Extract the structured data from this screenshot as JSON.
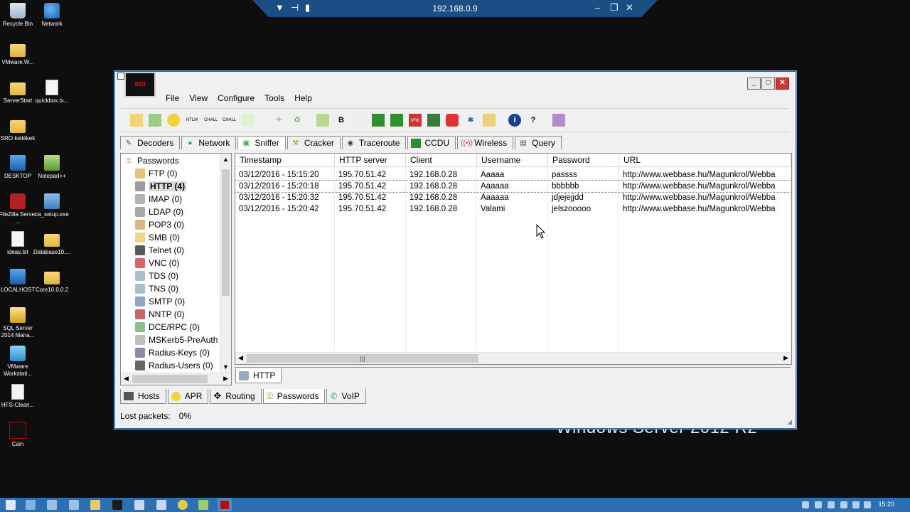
{
  "remote": {
    "title": "192.168.0.9"
  },
  "desktop": {
    "icons": [
      {
        "label": "Recycle Bin"
      },
      {
        "label": "Network"
      },
      {
        "label": "VMware.W..."
      },
      {
        "label": "ServerStart"
      },
      {
        "label": "quickbox.tx..."
      },
      {
        "label": "SRO kellékek"
      },
      {
        "label": "DESKTOP"
      },
      {
        "label": "Notepad++"
      },
      {
        "label": "FileZilla Server ..."
      },
      {
        "label": "ca_setup.exe"
      },
      {
        "label": "ideas.txt"
      },
      {
        "label": "Database10...."
      },
      {
        "label": "LOCALHOST"
      },
      {
        "label": "Core10.0.0.2"
      },
      {
        "label": "SQL Server 2014 Mana..."
      },
      {
        "label": "VMware Workstati..."
      },
      {
        "label": "HFS-Clean..."
      },
      {
        "label": "Cain"
      }
    ],
    "watermark": "Windows Server 2012 R2"
  },
  "window": {
    "logo": "aın",
    "menu": [
      "File",
      "View",
      "Configure",
      "Tools",
      "Help"
    ],
    "tabs": [
      "Decoders",
      "Network",
      "Sniffer",
      "Cracker",
      "Traceroute",
      "CCDU",
      "Wireless",
      "Query"
    ],
    "tree": {
      "root": "Passwords",
      "items": [
        "FTP (0)",
        "HTTP (4)",
        "IMAP (0)",
        "LDAP (0)",
        "POP3 (0)",
        "SMB (0)",
        "Telnet (0)",
        "VNC (0)",
        "TDS (0)",
        "TNS (0)",
        "SMTP (0)",
        "NNTP (0)",
        "DCE/RPC (0)",
        "MSKerb5-PreAuth",
        "Radius-Keys (0)",
        "Radius-Users (0)"
      ]
    },
    "table": {
      "columns": [
        "Timestamp",
        "HTTP server",
        "Client",
        "Username",
        "Password",
        "URL"
      ],
      "rows": [
        [
          "03/12/2016 - 15:15:20",
          "195.70.51.42",
          "192.168.0.28",
          "Aaaaa",
          "passss",
          "http://www.webbase.hu/Magunkrol/Webba"
        ],
        [
          "03/12/2016 - 15:20:18",
          "195.70.51.42",
          "192.168.0.28",
          "Aaaaaa",
          "bbbbbb",
          "http://www.webbase.hu/Magunkrol/Webba"
        ],
        [
          "03/12/2016 - 15:20:32",
          "195.70.51.42",
          "192.168.0.28",
          "Aaaaaa",
          "jdjejejjdd",
          "http://www.webbase.hu/Magunkrol/Webba"
        ],
        [
          "03/12/2016 - 15:20:42",
          "195.70.51.42",
          "192.168.0.28",
          "Valami",
          "jelszooooo",
          "http://www.webbase.hu/Magunkrol/Webba"
        ]
      ]
    },
    "subtab": "HTTP",
    "bottom_tabs": [
      "Hosts",
      "APR",
      "Routing",
      "Passwords",
      "VoIP"
    ],
    "status": {
      "label": "Lost packets:",
      "value": "0%"
    }
  },
  "taskbar": {
    "clock": "15:20"
  },
  "colors": {
    "titlebar": "#1c4e86",
    "taskbar": "#2c6fb3",
    "close": "#c83c31"
  }
}
